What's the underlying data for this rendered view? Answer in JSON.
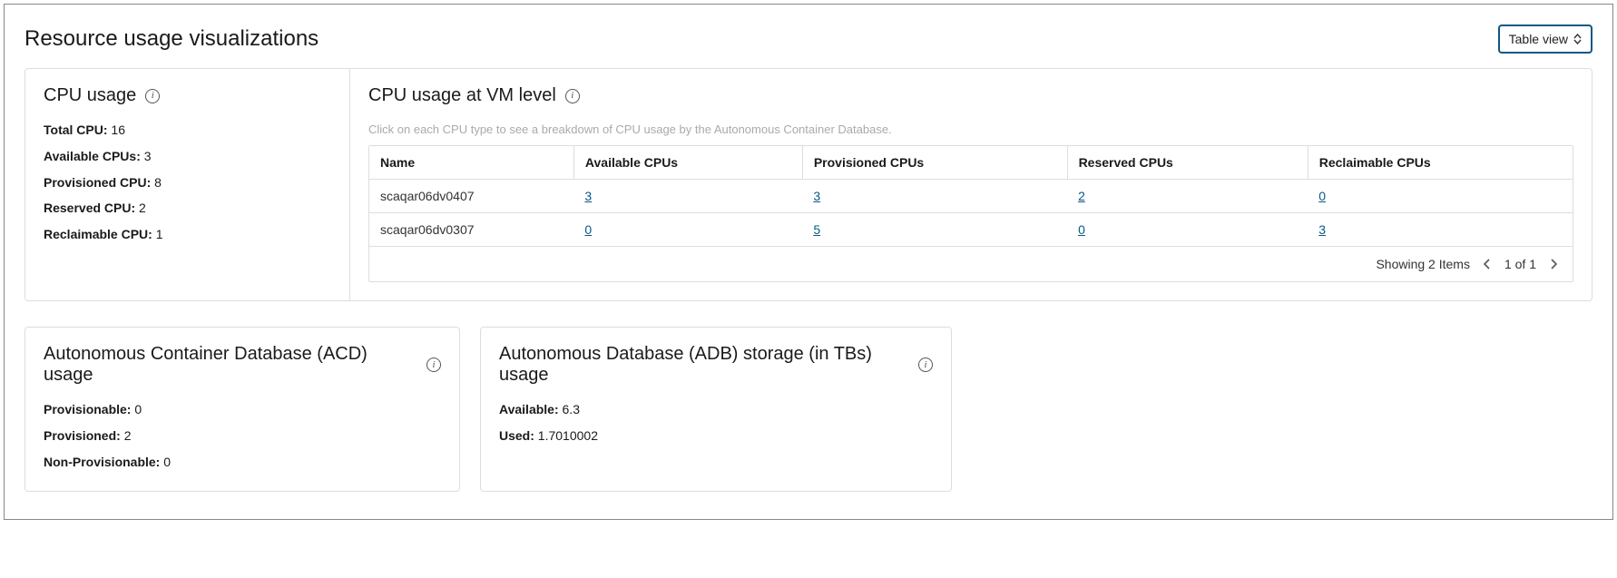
{
  "header": {
    "title": "Resource usage visualizations",
    "view_toggle_label": "Table view"
  },
  "cpu_usage": {
    "title": "CPU usage",
    "items": [
      {
        "label": "Total CPU:",
        "value": "16"
      },
      {
        "label": "Available CPUs:",
        "value": "3"
      },
      {
        "label": "Provisioned CPU:",
        "value": "8"
      },
      {
        "label": "Reserved CPU:",
        "value": "2"
      },
      {
        "label": "Reclaimable CPU:",
        "value": "1"
      }
    ]
  },
  "vm_level": {
    "title": "CPU usage at VM level",
    "hint": "Click on each CPU type to see a breakdown of CPU usage by the Autonomous Container Database.",
    "columns": {
      "name": "Name",
      "available": "Available CPUs",
      "provisioned": "Provisioned CPUs",
      "reserved": "Reserved CPUs",
      "reclaimable": "Reclaimable CPUs"
    },
    "rows": [
      {
        "name": "scaqar06dv0407",
        "available": "3",
        "provisioned": "3",
        "reserved": "2",
        "reclaimable": "0"
      },
      {
        "name": "scaqar06dv0307",
        "available": "0",
        "provisioned": "5",
        "reserved": "0",
        "reclaimable": "3"
      }
    ],
    "footer": {
      "showing": "Showing 2 Items",
      "page": "1 of 1"
    }
  },
  "acd": {
    "title": "Autonomous Container Database (ACD) usage",
    "items": [
      {
        "label": "Provisionable:",
        "value": "0"
      },
      {
        "label": "Provisioned:",
        "value": "2"
      },
      {
        "label": "Non-Provisionable:",
        "value": "0"
      }
    ]
  },
  "adb": {
    "title": "Autonomous Database (ADB) storage (in TBs) usage",
    "items": [
      {
        "label": "Available:",
        "value": "6.3"
      },
      {
        "label": "Used:",
        "value": "1.7010002"
      }
    ]
  }
}
